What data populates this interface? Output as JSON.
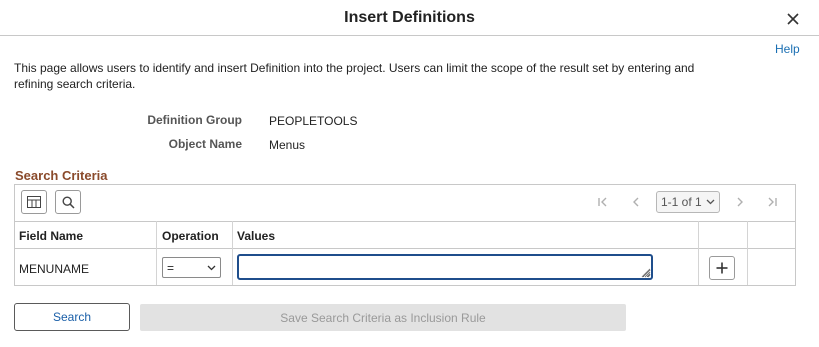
{
  "dialog": {
    "title": "Insert Definitions",
    "help_label": "Help",
    "description": "This page allows users to identify and insert Definition into the project. Users can limit the scope of the result set by entering and refining search criteria."
  },
  "fields": {
    "definition_group_label": "Definition Group",
    "definition_group_value": "PEOPLETOOLS",
    "object_name_label": "Object Name",
    "object_name_value": "Menus"
  },
  "search_criteria": {
    "section_title": "Search Criteria",
    "pager": "1-1 of 1",
    "columns": [
      "Field Name",
      "Operation",
      "Values"
    ],
    "rows": [
      {
        "field_name": "MENUNAME",
        "operation": "=",
        "value": ""
      }
    ]
  },
  "buttons": {
    "search": "Search",
    "save_inclusion_rule": "Save Search Criteria as Inclusion Rule"
  },
  "icons": {
    "close": "close-icon",
    "personalize": "grid-personalize-icon",
    "find": "search-icon",
    "first": "first-page-icon",
    "previous": "previous-page-icon",
    "next": "next-page-icon",
    "last": "last-page-icon",
    "add_row": "plus-icon"
  },
  "colors": {
    "section_title": "#8a4a2b",
    "link": "#1a6fb3",
    "focus_border": "#1f4e8c"
  }
}
